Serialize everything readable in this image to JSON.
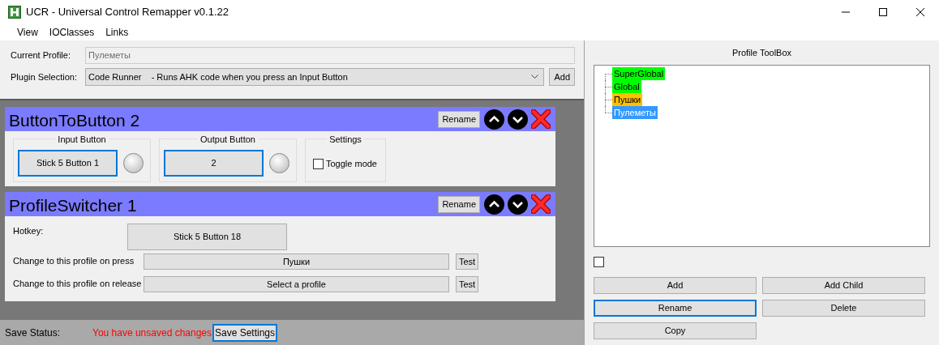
{
  "window": {
    "title": "UCR - Universal Control Remapper v0.1.22"
  },
  "menu": [
    "View",
    "IOClasses",
    "Links"
  ],
  "profile_form": {
    "current_profile_label": "Current Profile:",
    "current_profile": "Пулеметы",
    "plugin_label": "Plugin Selection:",
    "plugin_selection": "Code Runner    - Runs AHK code when you press an Input Button",
    "add_button": "Add"
  },
  "plugins": [
    {
      "kind": "button_to_button",
      "title": "ButtonToButton 2",
      "rename": "Rename",
      "groups": [
        {
          "title": "Input Button",
          "button": "Stick 5 Button 1",
          "focused": true,
          "lit": false
        },
        {
          "title": "Output Button",
          "button": "2",
          "focused": true,
          "lit": false
        }
      ],
      "settings": {
        "title": "Settings",
        "label": "Toggle mode",
        "checked": false
      }
    },
    {
      "kind": "profile_switcher",
      "title": "ProfileSwitcher 1",
      "rename": "Rename",
      "hotkey_label": "Hotkey:",
      "hotkey": "Stick 5 Button 18",
      "rows": [
        {
          "label": "Change to this profile on press",
          "value": "Пушки",
          "test": "Test"
        },
        {
          "label": "Change to this profile on release",
          "value": "Select a profile",
          "test": "Test"
        }
      ]
    }
  ],
  "save_bar": {
    "label": "Save Status:",
    "status": "You have unsaved changes",
    "button": "Save Settings",
    "focused": true
  },
  "toolbox": {
    "title": "Profile ToolBox",
    "tree": [
      {
        "label": "SuperGlobal",
        "color": "#00ff00",
        "selected": false
      },
      {
        "label": "Global",
        "color": "#00ff00",
        "selected": false
      },
      {
        "label": "Пушки",
        "color": "#ffc000",
        "selected": false
      },
      {
        "label": "Пулеметы",
        "selected": true
      }
    ],
    "checked": false,
    "buttons": [
      {
        "label": "Add",
        "focused": false
      },
      {
        "label": "Add Child",
        "focused": false
      },
      {
        "label": "Rename",
        "focused": true
      },
      {
        "label": "Delete",
        "focused": false
      },
      {
        "label": "Copy",
        "focused": false
      }
    ]
  }
}
